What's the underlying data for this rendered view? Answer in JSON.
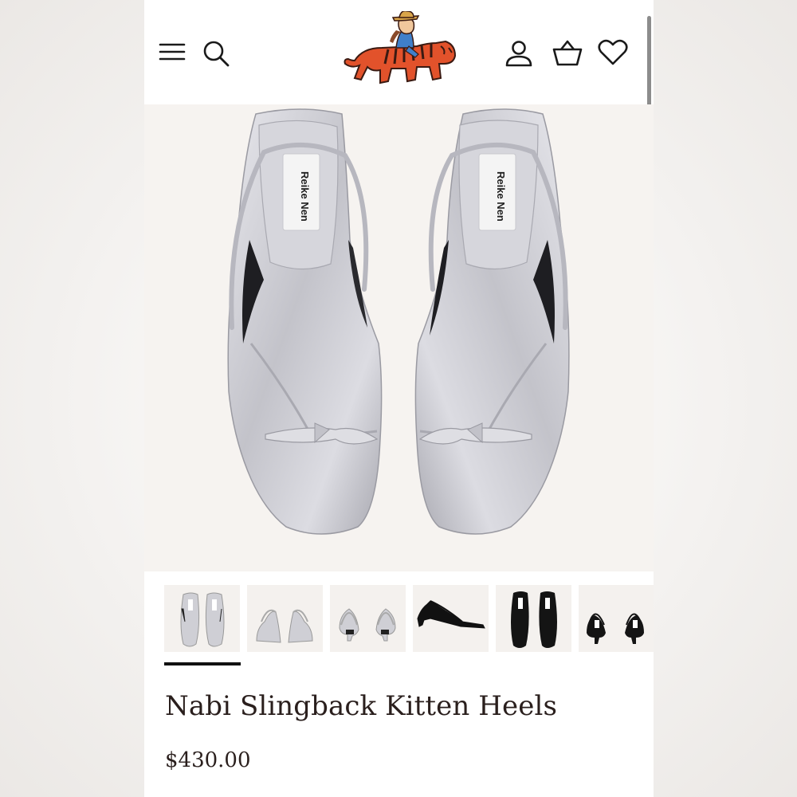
{
  "header": {
    "icons": [
      "menu-icon",
      "search-icon",
      "account-icon",
      "cart-icon",
      "heart-icon"
    ],
    "logo": "tiger-rider-logo"
  },
  "hero": {
    "image": "silver-slingback-sandals-top-view",
    "insole_label": "Reike Nen"
  },
  "thumbnails": [
    {
      "image": "silver-pair-top-view",
      "selected": true
    },
    {
      "image": "silver-pair-front-view",
      "selected": false
    },
    {
      "image": "silver-pair-back-view",
      "selected": false
    },
    {
      "image": "black-single-side-view",
      "selected": false
    },
    {
      "image": "black-pair-top-view",
      "selected": false
    },
    {
      "image": "black-pair-back-view",
      "selected": false
    }
  ],
  "product": {
    "title": "Nabi Slingback Kitten Heels",
    "price": "$430.00"
  },
  "colors": {
    "text": "#2a1f1d",
    "logo_tiger": "#e2522b",
    "silver": "#c9c9cf",
    "background": "#f6f3f0"
  }
}
